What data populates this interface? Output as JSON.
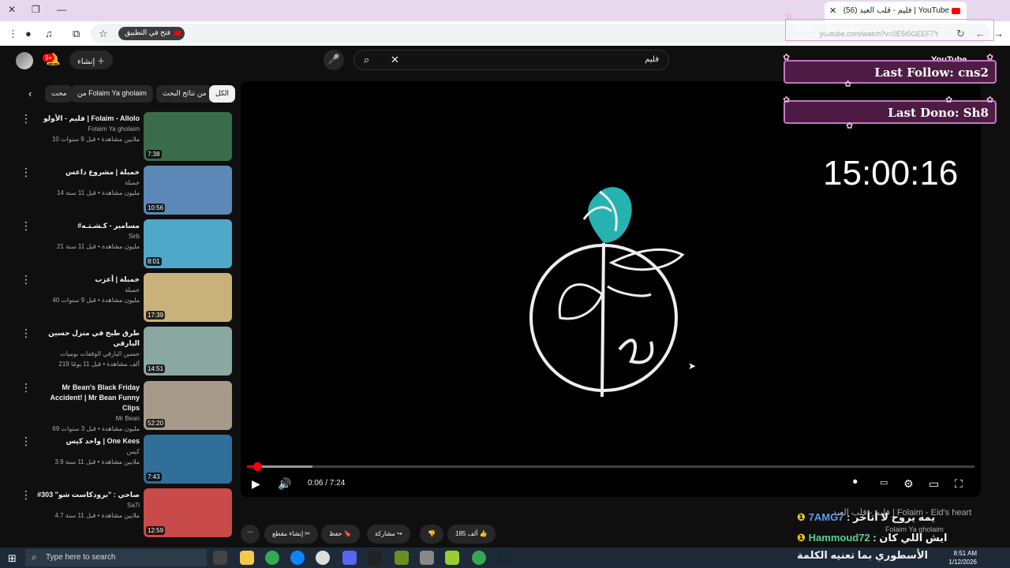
{
  "browser": {
    "tab_title": "(56) فليم - قلب العيد | YouTube",
    "open_in_app": "فتح في التطبيق",
    "url": "youtube.com/watch?v=0E5t5GEEF7Y"
  },
  "header": {
    "create_label": "إنشاء",
    "notification_count": "9+",
    "search_value": "فليم"
  },
  "chips": [
    {
      "label": "الكل"
    },
    {
      "label": "من نتائج البحث"
    },
    {
      "label": "من Folaim Ya gholaim"
    },
    {
      "label": "محت"
    }
  ],
  "videos": [
    {
      "title": "فليم - الأولو | Folaim - Allolo",
      "channel": "Folaim Ya gholaim",
      "stats": "10 ملايين مشاهدة • قبل 9 سنوات",
      "duration": "7:38",
      "color": "#3a6b4a"
    },
    {
      "title": "خمبلة | مشروع داعس",
      "channel": "خمبلة",
      "stats": "14 مليون مشاهدة • قبل 11 سنة",
      "duration": "10:56",
      "color": "#5c88b8"
    },
    {
      "title": "#مسامير - كـشـتـه",
      "channel": "Sirb",
      "stats": "21 مليون مشاهدة • قبل 11 سنة",
      "duration": "8:01",
      "color": "#4fa7c9"
    },
    {
      "title": "خمبلة | أعزب",
      "channel": "خمبلة",
      "stats": "40 مليون مشاهدة • قبل 9 سنوات",
      "duration": "17:39",
      "color": "#c9b27a"
    },
    {
      "title": "طرق طبخ في منزل حسين البارقي",
      "channel": "حسين البارقي الوقفات بوميات",
      "stats": "219 ألف مشاهدة • قبل 11 يومًا",
      "duration": "14:51",
      "color": "#8aa7a0"
    },
    {
      "title": "Mr Bean's Black Friday Accident! | Mr Bean Funny Clips",
      "channel": "Mr Bean",
      "stats": "69 مليون مشاهدة • قبل 3 سنوات",
      "duration": "52:20",
      "color": "#a89a8a"
    },
    {
      "title": "واحد كيس | One Kees",
      "channel": "كيس",
      "stats": "3.9 ملايين مشاهدة • قبل 11 سنة",
      "duration": "7:43",
      "color": "#2f6f9a"
    },
    {
      "title": "#صاحي : \"برودكاست شو\" 303",
      "channel": "Sa7i",
      "stats": "4.7 ملايين مشاهدة • قبل 11 سنة",
      "duration": "12:59",
      "color": "#c84a4a"
    }
  ],
  "player": {
    "current_time": "0:06",
    "total_time": "7:24",
    "time_display": "0:06 / 7:24",
    "progress_fraction": 0.014,
    "buffer_fraction": 0.09
  },
  "actions": {
    "likes": "185 ألف",
    "share": "مشاركة",
    "save": "حفظ",
    "clip": "إنشاء مقطع"
  },
  "overlay": {
    "subs": "Subs: Jwma",
    "youtube_label": "YouTube",
    "last_follow": "Last Follow: cns2",
    "last_dono": "Last Dono: Sh8",
    "clock": "15:00:16",
    "now_playing": "فليم - قلب العيد | Folaim - Eid's heart",
    "now_playing_channel": "Folaim Ya gholaim"
  },
  "chat": [
    {
      "user": "7AMG7",
      "message": "يمه يروح لا أتأخر"
    },
    {
      "user": "Hammoud72",
      "message": "ايش اللي كان"
    },
    {
      "user": "",
      "message": "الأسطوري بما تعنيه الكلمة"
    }
  ],
  "taskbar": {
    "search_placeholder": "Type here to search",
    "time": "8:51 AM",
    "date": "1/12/2026"
  },
  "colors": {
    "accent_red": "#ff0000",
    "overlay_purple": "#5a1e50",
    "chat_blue": "#5b9ce8"
  }
}
